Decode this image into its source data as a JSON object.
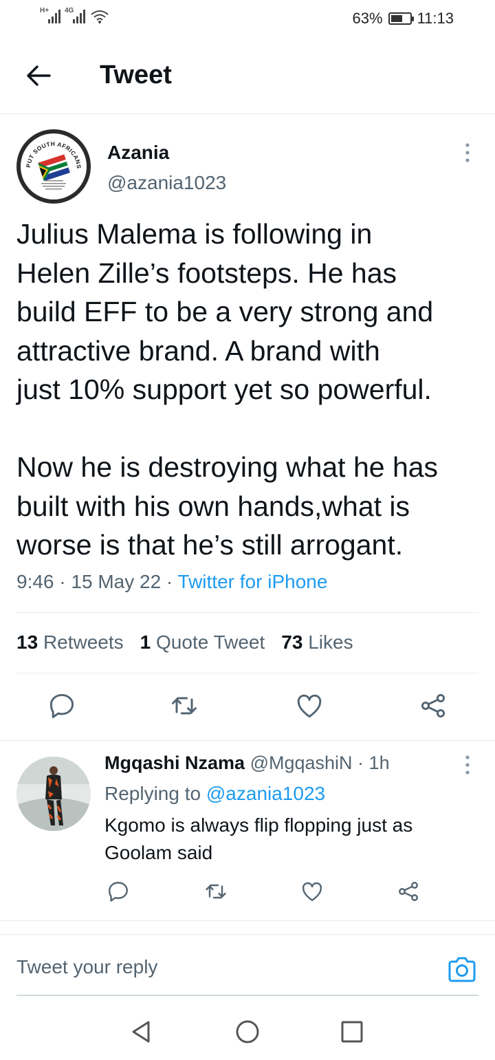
{
  "status_bar": {
    "signal1_label": "H+",
    "signal2_label": "4G",
    "battery_percent": "63%",
    "battery_level": 0.63,
    "time": "11:13"
  },
  "header": {
    "title": "Tweet",
    "back_icon": "arrow-left-icon"
  },
  "tweet": {
    "author_name": "Azania",
    "author_handle": "@azania1023",
    "text": "Julius Malema is following in\nHelen Zille’s footsteps. He has\nbuild EFF to be a very strong and\nattractive brand. A brand with\njust 10% support yet so powerful.\n\nNow he is destroying what he has\nbuilt with his own hands,what is\nworse is that he’s still arrogant.",
    "time": "9:46",
    "date": "15 May 22",
    "source": "Twitter for iPhone",
    "stats": {
      "retweets_count": "13",
      "retweets_label": "Retweets",
      "quotes_count": "1",
      "quotes_label": "Quote Tweet",
      "likes_count": "73",
      "likes_label": "Likes"
    },
    "avatar_text": {
      "top": "PUT SOUTH AFRICANS FIRST"
    }
  },
  "reply": {
    "author_name": "Mgqashi Nzama",
    "author_handle": "@MgqashiN",
    "age": "1h",
    "replying_prefix": "Replying to",
    "replying_handle": "@azania1023",
    "text": "Kgomo is always flip flopping just as Goolam said"
  },
  "compose": {
    "placeholder": "Tweet your reply"
  },
  "colors": {
    "accent": "#1d9bf0",
    "secondary_text": "#536471",
    "divider": "#e6ecf0",
    "icon": "#536471"
  }
}
